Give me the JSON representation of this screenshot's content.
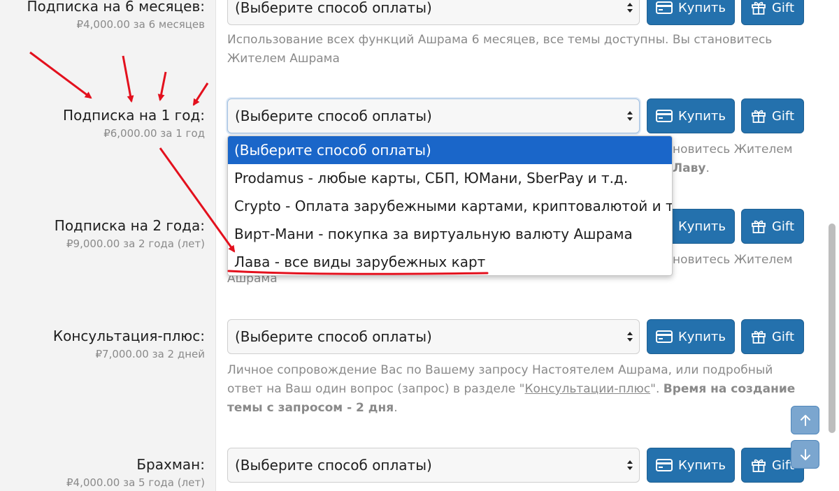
{
  "common": {
    "select_placeholder": "(Выберите способ оплаты)",
    "buy_label": "Купить",
    "gift_label": "Gift"
  },
  "rows": [
    {
      "title": "Подписка на 6 месяцев:",
      "price": "₽4,000.00 за 6 месяцев",
      "description_line1": "Использование всех функций Ашрама 6 месяцев, все темы доступны. Вы становитесь",
      "description_line2": "Жителем Ашрама"
    },
    {
      "title": "Подписка на 1 год:",
      "price": "₽6,000.00 за 1 год",
      "description_frag1": "новитесь Жителем",
      "description_frag2": "Лаву"
    },
    {
      "title": "Подписка на 2 года:",
      "price": "₽9,000.00 за 2 года (лет)",
      "description_frag1": "новитесь Жителем",
      "description_frag2": "Ашрама"
    },
    {
      "title": "Консультация-плюс:",
      "price": "₽7,000.00 за 2 дней",
      "description_part1": "Личное сопровождение Вас по Вашему запросу Настоятелем Ашрама, или подробный ответ на Ваш один вопрос (запрос) в разделе \"",
      "description_link": "Консультации-плюс",
      "description_part2": "\". ",
      "description_bold": "Время на создание темы с запросом - 2 дня",
      "description_part3": "."
    },
    {
      "title": "Брахман:",
      "price": "₽4,000.00 за 5 года (лет)"
    }
  ],
  "dropdown": {
    "options": [
      "(Выберите способ оплаты)",
      "Prodamus - любые карты, СБП, ЮМани, SberPay и т.д.",
      "Crypto - Оплата зарубежными картами, криптовалютой и т.д.",
      "Вирт-Мани - покупка за виртуальную валюту Ашрама",
      "Лава - все виды зарубежных карт"
    ],
    "selected_index": 0
  },
  "icons": {
    "buy": "credit-card-icon",
    "gift": "gift-icon",
    "scroll_up": "arrow-up-icon",
    "scroll_down": "arrow-down-icon",
    "select_arrows": "chevron-up-down-icon"
  },
  "colors": {
    "primary_button": "#2471ad",
    "dropdown_selected": "#1a66c9",
    "annotation": "#e3101d",
    "muted_text": "#8a8a8a"
  }
}
